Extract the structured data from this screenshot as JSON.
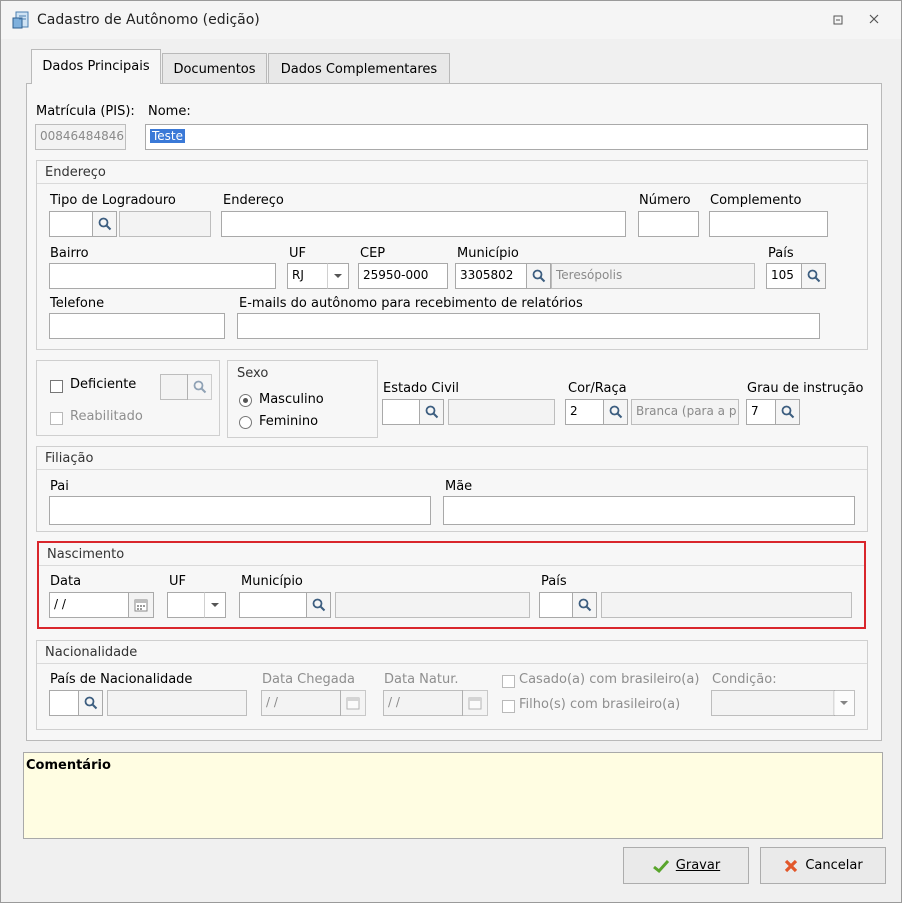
{
  "window": {
    "title": "Cadastro de Autônomo (edição)",
    "restore_icon": "restore-icon",
    "close_icon": "close-icon"
  },
  "tabs": [
    {
      "label": "Dados Principais",
      "active": true
    },
    {
      "label": "Documentos"
    },
    {
      "label": "Dados Complementares"
    }
  ],
  "main": {
    "matricula_label": "Matrícula (PIS):",
    "matricula_value": "00846484846",
    "nome_label": "Nome:",
    "nome_value": "Teste"
  },
  "endereco": {
    "group_title": "Endereço",
    "tipo_logradouro_label": "Tipo de Logradouro",
    "endereco_label": "Endereço",
    "numero_label": "Número",
    "complemento_label": "Complemento",
    "bairro_label": "Bairro",
    "uf_label": "UF",
    "uf_value": "RJ",
    "cep_label": "CEP",
    "cep_value": "25950-000",
    "municipio_label": "Município",
    "municipio_code": "3305802",
    "municipio_name": "Teresópolis",
    "pais_label": "País",
    "pais_value": "105",
    "telefone_label": "Telefone",
    "emails_label": "E-mails do autônomo para recebimento de relatórios"
  },
  "deficiencia": {
    "deficiente_label": "Deficiente",
    "reabilitado_label": "Reabilitado"
  },
  "sexo": {
    "group_title": "Sexo",
    "masculino": "Masculino",
    "feminino": "Feminino",
    "selected": "Masculino"
  },
  "estado_civil": {
    "label": "Estado Civil"
  },
  "cor_raca": {
    "label": "Cor/Raça",
    "code": "2",
    "name": "Branca (para a p"
  },
  "grau_instrucao": {
    "label": "Grau de instrução",
    "code": "7"
  },
  "filiacao": {
    "group_title": "Filiação",
    "pai_label": "Pai",
    "mae_label": "Mãe"
  },
  "nascimento": {
    "group_title": "Nascimento",
    "data_label": "Data",
    "data_value": " / /",
    "uf_label": "UF",
    "municipio_label": "Município",
    "pais_label": "País",
    "highlight_color": "#d9262c"
  },
  "nacionalidade": {
    "group_title": "Nacionalidade",
    "pais_label": "País de Nacionalidade",
    "data_chegada_label": "Data Chegada",
    "data_chegada_value": " / /",
    "data_natur_label": "Data Natur.",
    "data_natur_value": " / /",
    "casado_label": "Casado(a) com brasileiro(a)",
    "filhos_label": "Filho(s) com brasileiro(a)",
    "condicao_label": "Condição:"
  },
  "comentario": {
    "label": "Comentário",
    "background": "#fffde2"
  },
  "actions": {
    "gravar": "Gravar",
    "cancelar": "Cancelar",
    "gravar_icon": "check-icon",
    "cancelar_icon": "x-icon"
  }
}
